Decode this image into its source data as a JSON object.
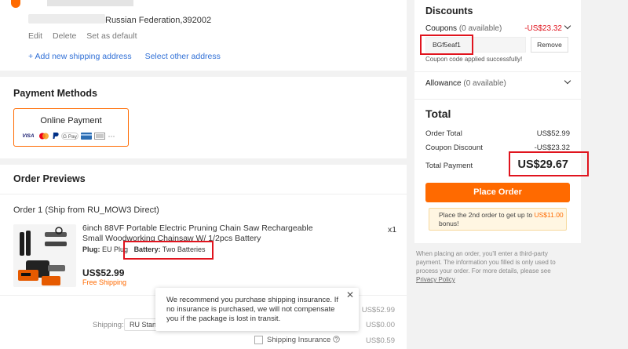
{
  "address": {
    "line_suffix": "Russian Federation,392002",
    "actions": [
      "Edit",
      "Delete",
      "Set as default"
    ],
    "add_link": "+ Add new shipping address",
    "select_link": "Select other address"
  },
  "payment": {
    "title": "Payment Methods",
    "method_label": "Online Payment",
    "icons": [
      "VISA",
      "mastercard",
      "paypal",
      "G Pay",
      "bank-card",
      "wallet",
      "more"
    ]
  },
  "order": {
    "title": "Order Previews",
    "order_label": "Order 1 (Ship from RU_MOW3 Direct)",
    "product_title": "6inch 88VF Portable Electric Pruning Chain Saw Rechargeable Small Woodworking Chainsaw W/ 1/2pcs Battery",
    "quantity": "x1",
    "plug_label": "Plug:",
    "plug_value": "EU Plug",
    "battery_label": "Battery:",
    "battery_value": "Two Batteries",
    "price": "US$52.99",
    "free_shipping": "Free Shipping",
    "subtotal_value": "US$52.99",
    "shipping_label": "Shipping:",
    "shipping_method": "RU Stand",
    "shipping_value": "US$0.00",
    "insurance_label": "Shipping Insurance",
    "insurance_value": "US$0.59"
  },
  "tooltip": {
    "text": "We recommend you purchase shipping insurance. If no insurance is purchased, we will not compensate you if the package is lost in transit.",
    "close": "✕"
  },
  "discounts": {
    "title": "Discounts",
    "coupons_label": "Coupons",
    "coupons_available": "(0 available)",
    "coupons_value": "-US$23.32",
    "coupon_code": "BGf5eaf1",
    "remove_label": "Remove",
    "applied_msg": "Coupon code applied successfully!",
    "allowance_label": "Allowance",
    "allowance_available": "(0 available)"
  },
  "total": {
    "title": "Total",
    "order_total_label": "Order Total",
    "order_total_value": "US$52.99",
    "coupon_discount_label": "Coupon Discount",
    "coupon_discount_value": "-US$23.32",
    "total_payment_label": "Total Payment",
    "total_payment_value": "US$29.67",
    "place_order": "Place Order",
    "promo_prefix": "Place the 2nd order to get up to",
    "promo_amount": "US$11.00",
    "promo_suffix": "bonus!"
  },
  "notice": {
    "text": "When placing an order, you'll enter a third-party payment. The information you filled is only used to process your order. For more details, please see",
    "link": "Privacy Policy"
  },
  "colors": {
    "accent": "#ff6a00",
    "highlight": "#e0141e",
    "link": "#2f6fd6"
  }
}
